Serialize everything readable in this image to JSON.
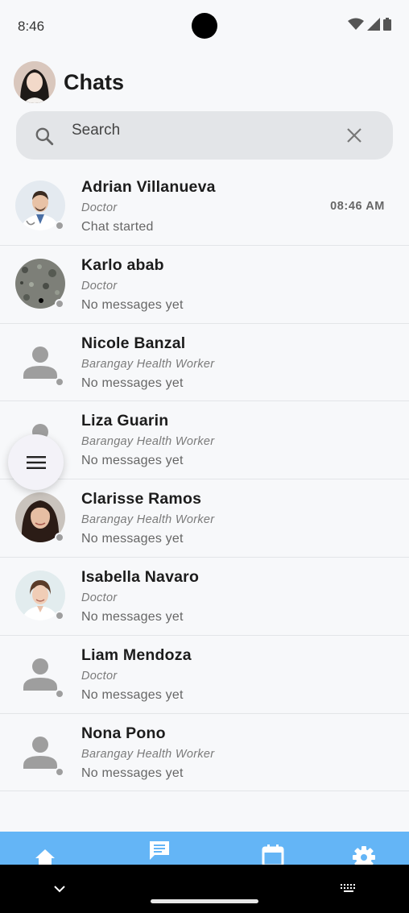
{
  "status_bar": {
    "time": "8:46"
  },
  "header": {
    "title": "Chats"
  },
  "search": {
    "placeholder": "Search"
  },
  "chats": [
    {
      "name": "Adrian Villanueva",
      "role": "Doctor",
      "preview": "Chat started",
      "time": "08:46 AM",
      "avatar": "doctor-male-photo"
    },
    {
      "name": "Karlo abab",
      "role": "Doctor",
      "preview": "No messages yet",
      "time": "",
      "avatar": "stone-texture-photo"
    },
    {
      "name": "Nicole Banzal",
      "role": "Barangay Health Worker",
      "preview": "No messages yet",
      "time": "",
      "avatar": "person-placeholder-icon"
    },
    {
      "name": "Liza Guarin",
      "role": "Barangay Health Worker",
      "preview": "No messages yet",
      "time": "",
      "avatar": "person-placeholder-icon"
    },
    {
      "name": "Clarisse Ramos",
      "role": "Barangay Health Worker",
      "preview": "No messages yet",
      "time": "",
      "avatar": "woman-photo"
    },
    {
      "name": "Isabella Navaro",
      "role": "Doctor",
      "preview": "No messages yet",
      "time": "",
      "avatar": "doctor-female-photo"
    },
    {
      "name": "Liam Mendoza",
      "role": "Doctor",
      "preview": "No messages yet",
      "time": "",
      "avatar": "person-placeholder-icon"
    },
    {
      "name": "Nona Pono",
      "role": "Barangay Health Worker",
      "preview": "No messages yet",
      "time": "",
      "avatar": "person-placeholder-icon"
    }
  ],
  "bottom_nav": {
    "items": [
      "home-icon",
      "chat-icon",
      "calendar-icon",
      "settings-icon"
    ],
    "active": "chat-icon"
  },
  "colors": {
    "accent": "#64b5f6",
    "background": "#f7f8fa",
    "search_bg": "#e3e5e8",
    "status_dot": "#9e9e9e"
  }
}
